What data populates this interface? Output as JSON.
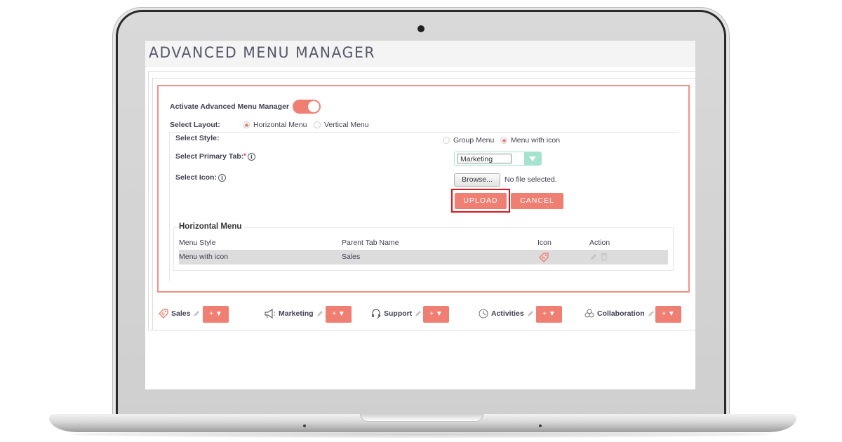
{
  "page": {
    "title": "ADVANCED MENU MANAGER"
  },
  "settings": {
    "activate_label": "Activate Advanced Menu Manager",
    "activate_on": true,
    "layout_label": "Select Layout:",
    "layout_options": [
      {
        "label": "Horizontal Menu",
        "selected": true
      },
      {
        "label": "Vertical Menu",
        "selected": false
      }
    ],
    "style_label": "Select Style:",
    "style_options": [
      {
        "label": "Group Menu",
        "selected": false
      },
      {
        "label": "Menu with icon",
        "selected": true
      }
    ],
    "primary_tab_label": "Select Primary Tab:",
    "required_mark": "*",
    "info_glyph": "i",
    "primary_tab_value": "Marketing",
    "icon_label": "Select Icon:",
    "browse_label": "Browse...",
    "file_status": "No file selected.",
    "upload_label": "UPLOAD",
    "cancel_label": "CANCEL"
  },
  "horizontal_menu": {
    "title": "Horizontal Menu",
    "columns": [
      "Menu Style",
      "Parent Tab Name",
      "Icon",
      "Action"
    ],
    "rows": [
      {
        "menu_style": "Menu with icon",
        "parent_tab": "Sales",
        "icon": "tag-icon",
        "actions": [
          "edit-icon",
          "trash-icon"
        ]
      }
    ]
  },
  "nav_bar": {
    "items": [
      {
        "label": "Sales",
        "icon": "tag-icon",
        "button_label": "+ ▼"
      },
      {
        "label": "Marketing",
        "icon": "megaphone-icon",
        "button_label": "+ ▼"
      },
      {
        "label": "Support",
        "icon": "headset-icon",
        "button_label": "+ ▼"
      },
      {
        "label": "Activities",
        "icon": "clock-icon",
        "button_label": "+ ▼"
      },
      {
        "label": "Collaboration",
        "icon": "collaboration-icon",
        "button_label": "+ ▼"
      }
    ]
  },
  "colors": {
    "accent": "#f07f73",
    "highlight_outline": "#e0141a",
    "select_accent": "#a6e3cf"
  }
}
